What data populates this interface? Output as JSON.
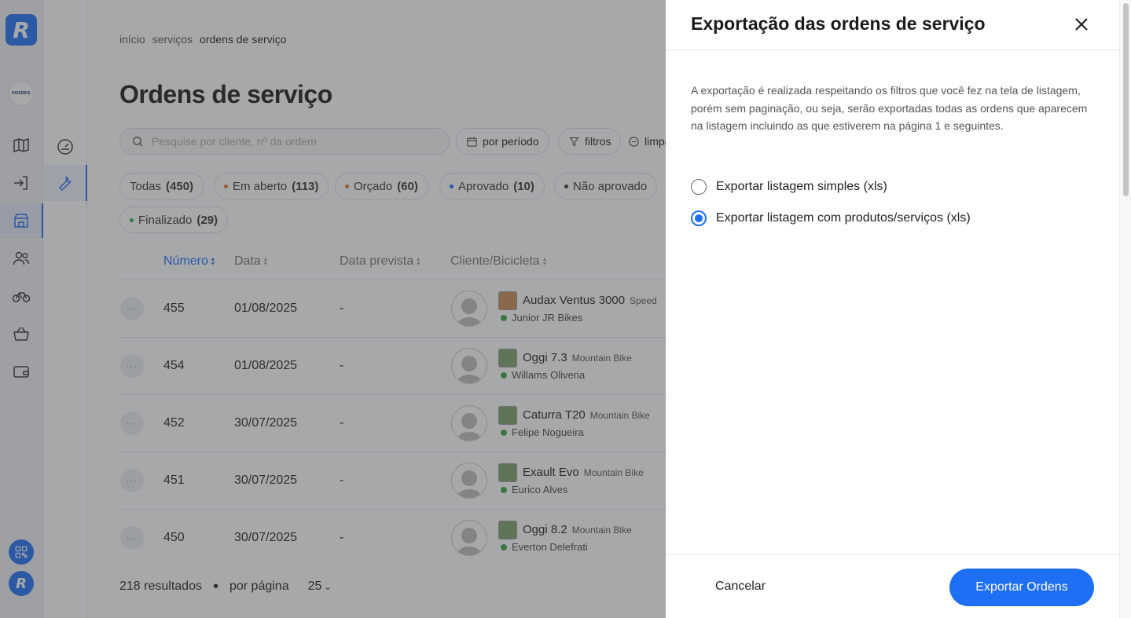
{
  "sidebar": {
    "logo_letter": "R",
    "store_avatar_text": "RIDEBIKE",
    "user_letter": "R",
    "items": [
      {
        "icon": "map-icon"
      },
      {
        "icon": "login-icon"
      },
      {
        "icon": "store-icon"
      },
      {
        "icon": "users-icon"
      },
      {
        "icon": "bicycle-icon"
      },
      {
        "icon": "basket-icon"
      },
      {
        "icon": "wallet-icon"
      }
    ],
    "sub_items": [
      {
        "icon": "dashboard-icon"
      },
      {
        "icon": "wrench-icon"
      }
    ]
  },
  "breadcrumb": [
    "início",
    "serviços",
    "ordens de serviço"
  ],
  "page_title": "Ordens de serviço",
  "search": {
    "placeholder": "Pesquise por cliente, nº da ordem"
  },
  "toolbar": {
    "period_label": "por período",
    "filters_label": "filtros",
    "clear_label": "limpar"
  },
  "status_chips": [
    {
      "label": "Todas",
      "count": "(450)",
      "dot": ""
    },
    {
      "label": "Em aberto",
      "count": "(113)",
      "dot": "#e0792c"
    },
    {
      "label": "Orçado",
      "count": "(60)",
      "dot": "#e0792c"
    },
    {
      "label": "Aprovado",
      "count": "(10)",
      "dot": "#1f6ff5"
    },
    {
      "label": "Não aprovado",
      "count": "",
      "dot": "#333333"
    },
    {
      "label": "Finalizado",
      "count": "(29)",
      "dot": "#3aa245"
    }
  ],
  "table": {
    "headers": [
      "Número",
      "Data",
      "Data prevista",
      "Cliente/Bicicleta"
    ],
    "rows": [
      {
        "more": "···",
        "number": "455",
        "date": "01/08/2025",
        "expected": "-",
        "bike": "Audax Ventus 3000",
        "bike_type": "Speed",
        "client": "Junior JR Bikes"
      },
      {
        "more": "···",
        "number": "454",
        "date": "01/08/2025",
        "expected": "-",
        "bike": "Oggi 7.3",
        "bike_type": "Mountain Bike",
        "client": "Willams Oliveria"
      },
      {
        "more": "···",
        "number": "452",
        "date": "30/07/2025",
        "expected": "-",
        "bike": "Caturra T20",
        "bike_type": "Mountain Bike",
        "client": "Felipe Nogueira"
      },
      {
        "more": "···",
        "number": "451",
        "date": "30/07/2025",
        "expected": "-",
        "bike": "Exault Evo",
        "bike_type": "Mountain Bike",
        "client": "Eurico Alves"
      },
      {
        "more": "···",
        "number": "450",
        "date": "30/07/2025",
        "expected": "-",
        "bike": "Oggi 8.2",
        "bike_type": "Mountain Bike",
        "client": "Everton Delefrati"
      }
    ]
  },
  "footer": {
    "results": "218 resultados",
    "per_page_label": "por página",
    "per_page_value": "25"
  },
  "drawer": {
    "title": "Exportação das ordens de serviço",
    "description": "A exportação é realizada respeitando os filtros que você fez na tela de listagem, porém sem paginação, ou seja, serão exportadas todas as ordens que aparecem na listagem incluindo as que estiverem na página 1 e seguintes.",
    "options": [
      {
        "label": "Exportar listagem simples (xls)",
        "checked": false
      },
      {
        "label": "Exportar listagem com produtos/serviços (xls)",
        "checked": true
      }
    ],
    "cancel_label": "Cancelar",
    "export_label": "Exportar Ordens"
  },
  "colors": {
    "accent": "#1f6ff5",
    "status_green": "#3aa245",
    "status_orange": "#e0792c"
  }
}
